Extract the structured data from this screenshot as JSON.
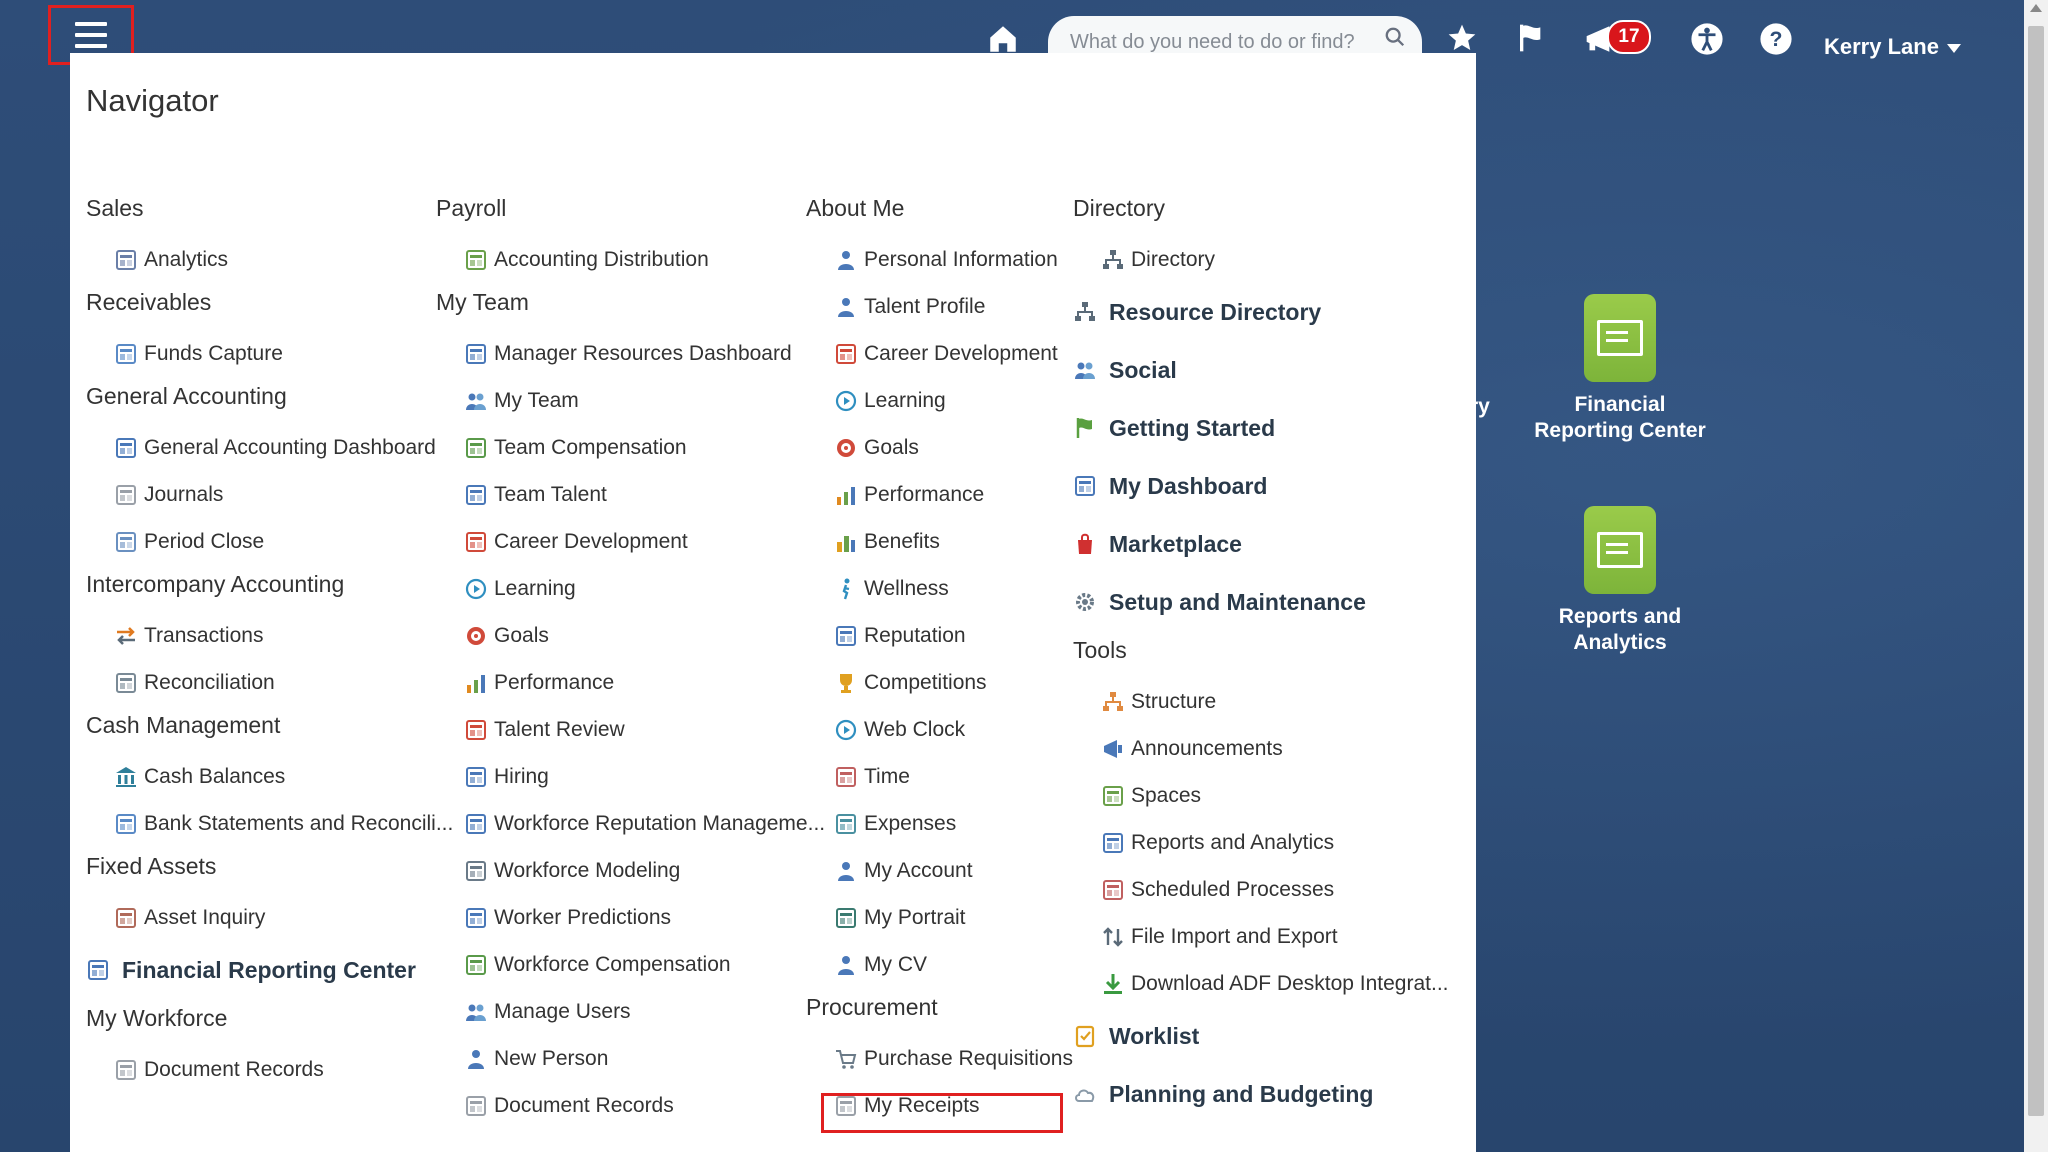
{
  "header": {
    "search_placeholder": "What do you need to do or find?",
    "notification_count": "17",
    "user_name": "Kerry Lane"
  },
  "navigator": {
    "title": "Navigator",
    "columns": [
      [
        {
          "heading": "Sales",
          "items": [
            {
              "label": "Analytics",
              "icon": "analytics-icon"
            }
          ]
        },
        {
          "heading": "Receivables",
          "items": [
            {
              "label": "Funds Capture",
              "icon": "funds-capture-icon"
            }
          ]
        },
        {
          "heading": "General Accounting",
          "items": [
            {
              "label": "General Accounting Dashboard",
              "icon": "dashboard-icon"
            },
            {
              "label": "Journals",
              "icon": "journals-icon"
            },
            {
              "label": "Period Close",
              "icon": "period-close-icon"
            }
          ]
        },
        {
          "heading": "Intercompany Accounting",
          "items": [
            {
              "label": "Transactions",
              "icon": "transactions-icon"
            },
            {
              "label": "Reconciliation",
              "icon": "reconciliation-icon"
            }
          ]
        },
        {
          "heading": "Cash Management",
          "items": [
            {
              "label": "Cash Balances",
              "icon": "bank-icon"
            },
            {
              "label": "Bank Statements and Reconcili...",
              "icon": "bank-statements-icon"
            }
          ]
        },
        {
          "heading": "Fixed Assets",
          "items": [
            {
              "label": "Asset Inquiry",
              "icon": "asset-inquiry-icon"
            }
          ]
        },
        {
          "heading": null,
          "items": [
            {
              "label": "Financial Reporting Center",
              "icon": "financial-reporting-icon",
              "big": true
            }
          ]
        },
        {
          "heading": "My Workforce",
          "items": [
            {
              "label": "Document Records",
              "icon": "document-icon"
            }
          ]
        }
      ],
      [
        {
          "heading": "Payroll",
          "items": [
            {
              "label": "Accounting Distribution",
              "icon": "accounting-distribution-icon"
            }
          ]
        },
        {
          "heading": "My Team",
          "items": [
            {
              "label": "Manager Resources Dashboard",
              "icon": "dashboard-icon"
            },
            {
              "label": "My Team",
              "icon": "team-icon"
            },
            {
              "label": "Team Compensation",
              "icon": "compensation-icon"
            },
            {
              "label": "Team Talent",
              "icon": "talent-icon"
            },
            {
              "label": "Career Development",
              "icon": "career-icon"
            },
            {
              "label": "Learning",
              "icon": "learning-icon"
            },
            {
              "label": "Goals",
              "icon": "goals-icon"
            },
            {
              "label": "Performance",
              "icon": "performance-icon"
            },
            {
              "label": "Talent Review",
              "icon": "talent-review-icon"
            },
            {
              "label": "Hiring",
              "icon": "hiring-icon"
            },
            {
              "label": "Workforce Reputation Manageme...",
              "icon": "reputation-icon"
            },
            {
              "label": "Workforce Modeling",
              "icon": "modeling-icon"
            },
            {
              "label": "Worker Predictions",
              "icon": "predictions-icon"
            },
            {
              "label": "Workforce Compensation",
              "icon": "compensation-icon"
            },
            {
              "label": "Manage Users",
              "icon": "users-icon"
            },
            {
              "label": "New Person",
              "icon": "new-person-icon"
            },
            {
              "label": "Document Records",
              "icon": "document-icon"
            }
          ]
        }
      ],
      [
        {
          "heading": "About Me",
          "items": [
            {
              "label": "Personal Information",
              "icon": "person-icon"
            },
            {
              "label": "Talent Profile",
              "icon": "person-icon"
            },
            {
              "label": "Career Development",
              "icon": "career-icon"
            },
            {
              "label": "Learning",
              "icon": "learning-icon"
            },
            {
              "label": "Goals",
              "icon": "goals-icon"
            },
            {
              "label": "Performance",
              "icon": "performance-icon"
            },
            {
              "label": "Benefits",
              "icon": "benefits-icon"
            },
            {
              "label": "Wellness",
              "icon": "wellness-icon"
            },
            {
              "label": "Reputation",
              "icon": "reputation-icon"
            },
            {
              "label": "Competitions",
              "icon": "trophy-icon"
            },
            {
              "label": "Web Clock",
              "icon": "clock-icon"
            },
            {
              "label": "Time",
              "icon": "calendar-icon"
            },
            {
              "label": "Expenses",
              "icon": "expenses-icon"
            },
            {
              "label": "My Account",
              "icon": "account-icon"
            },
            {
              "label": "My Portrait",
              "icon": "portrait-icon"
            },
            {
              "label": "My CV",
              "icon": "cv-icon"
            }
          ]
        },
        {
          "heading": "Procurement",
          "items": [
            {
              "label": "Purchase Requisitions",
              "icon": "cart-icon"
            },
            {
              "label": "My Receipts",
              "icon": "receipt-icon"
            }
          ]
        }
      ],
      [
        {
          "heading": "Directory",
          "items": [
            {
              "label": "Directory",
              "icon": "org-chart-icon"
            }
          ]
        },
        {
          "heading": null,
          "items": [
            {
              "label": "Resource Directory",
              "icon": "org-chart-icon",
              "big": true
            },
            {
              "label": "Social",
              "icon": "social-icon",
              "big": true
            },
            {
              "label": "Getting Started",
              "icon": "flag-icon",
              "big": true
            },
            {
              "label": "My Dashboard",
              "icon": "dashboard-icon",
              "big": true
            },
            {
              "label": "Marketplace",
              "icon": "marketplace-icon",
              "big": true
            },
            {
              "label": "Setup and Maintenance",
              "icon": "gear-icon",
              "big": true
            }
          ]
        },
        {
          "heading": "Tools",
          "items": [
            {
              "label": "Structure",
              "icon": "structure-icon"
            },
            {
              "label": "Announcements",
              "icon": "megaphone-icon"
            },
            {
              "label": "Spaces",
              "icon": "spaces-icon"
            },
            {
              "label": "Reports and Analytics",
              "icon": "reports-icon"
            },
            {
              "label": "Scheduled Processes",
              "icon": "calendar-icon"
            },
            {
              "label": "File Import and Export",
              "icon": "import-export-icon"
            },
            {
              "label": "Download ADF Desktop Integrat...",
              "icon": "download-icon"
            }
          ]
        },
        {
          "heading": null,
          "items": [
            {
              "label": "Worklist",
              "icon": "worklist-icon",
              "big": true
            },
            {
              "label": "Planning and Budgeting",
              "icon": "cloud-icon",
              "big": true
            }
          ]
        }
      ]
    ]
  },
  "tiles": [
    {
      "label": "Financial Reporting Center",
      "icon": "financial-reporting-tile-icon"
    },
    {
      "label": "Reports and Analytics",
      "icon": "reports-tile-icon"
    }
  ],
  "partial_tile_text": "ry",
  "colors": {
    "accent": "#e02020",
    "header_bg": "#2e4d78",
    "tile_green": "#8cc043",
    "badge": "#d9161b"
  }
}
